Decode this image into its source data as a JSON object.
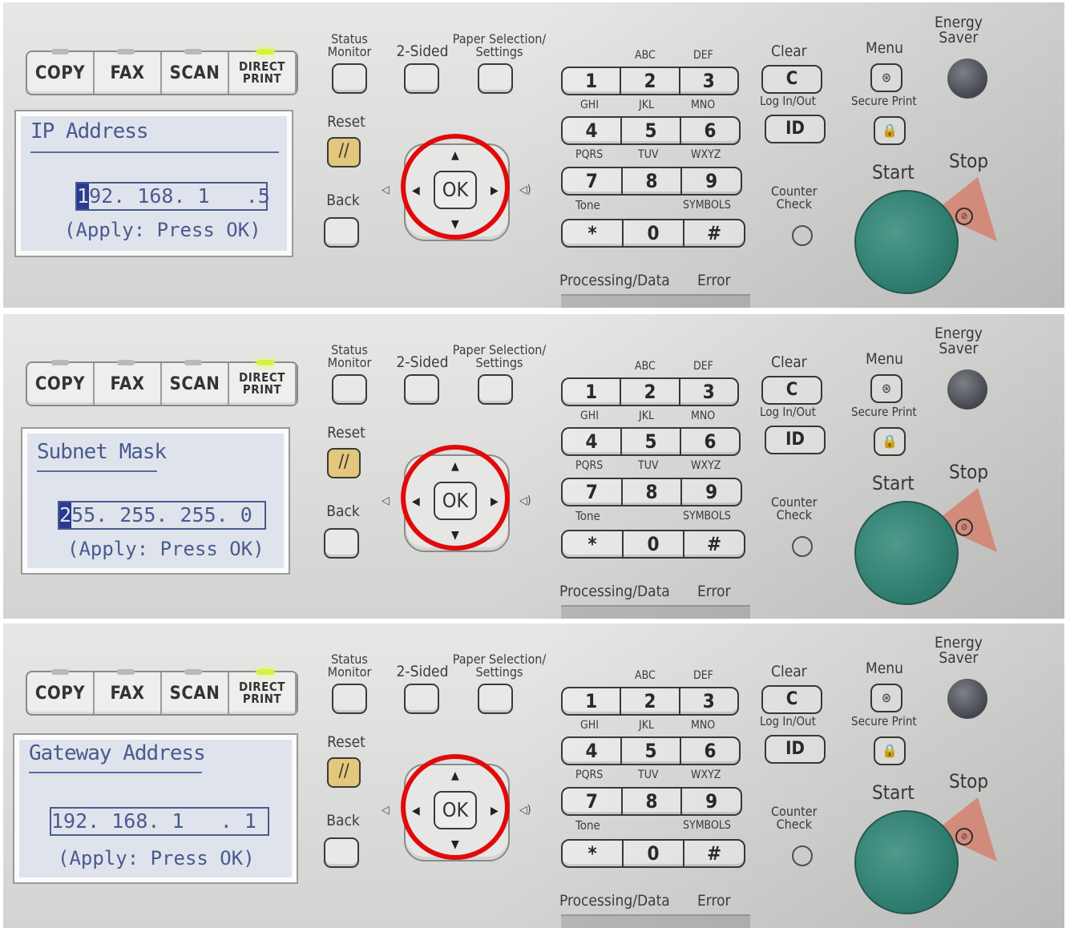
{
  "modes": [
    "COPY",
    "FAX",
    "SCAN"
  ],
  "direct_print": [
    "DIRECT",
    "PRINT"
  ],
  "labels": {
    "status_monitor": [
      "Status",
      "Monitor"
    ],
    "two_sided": "2-Sided",
    "paper_selection": [
      "Paper Selection/",
      "Settings"
    ],
    "reset": "Reset",
    "back": "Back",
    "ok": "OK",
    "clear": "Clear",
    "clear_key": "C",
    "log_in_out": "Log In/Out",
    "id_key": "ID",
    "menu": "Menu",
    "secure_print": "Secure Print",
    "energy_saver": [
      "Energy",
      "Saver"
    ],
    "start": "Start",
    "stop": "Stop",
    "counter_check": [
      "Counter",
      "Check"
    ],
    "processing_data": "Processing/Data",
    "error": "Error",
    "tone": "Tone",
    "symbols": "SYMBOLS"
  },
  "keypad": {
    "rows": [
      [
        "1",
        "2",
        "3"
      ],
      [
        "4",
        "5",
        "6"
      ],
      [
        "7",
        "8",
        "9"
      ],
      [
        "*",
        "0",
        "#"
      ]
    ],
    "letters": [
      [
        "ABC",
        "DEF"
      ],
      [
        "GHI",
        "JKL",
        "MNO"
      ],
      [
        "PQRS",
        "TUV",
        "WXYZ"
      ]
    ]
  },
  "screens": [
    {
      "title": "IP Address",
      "cursor": "1",
      "value": "92. 168. 1   .5",
      "apply": "(Apply: Press OK)"
    },
    {
      "title": "Subnet Mask",
      "cursor": "2",
      "value": "55. 255. 255. 0",
      "apply": "(Apply: Press OK)"
    },
    {
      "title": "Gateway Address",
      "cursor": "",
      "value": "192. 168. 1   . 1",
      "apply": "(Apply: Press OK)"
    }
  ],
  "colors": {
    "highlight_ring": "#e10a0a",
    "start": "#2f8576",
    "stop": "#e99a88",
    "led_on": "#d8f040"
  }
}
